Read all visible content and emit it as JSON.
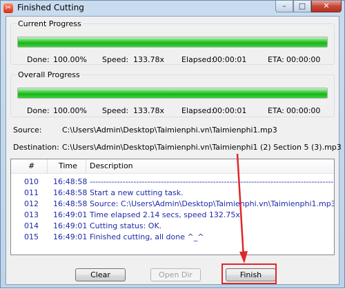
{
  "window": {
    "title": "Finished Cutting",
    "icon": "scissors-app-icon"
  },
  "title_buttons": {
    "minimize": "–",
    "maximize": "□",
    "close": "✕"
  },
  "current_progress": {
    "label": "Current Progress",
    "progress": 1.0,
    "done_label": "Done:",
    "done_value": "100.00%",
    "speed_label": "Speed:",
    "speed_value": "133.78x",
    "elapsed_label": "Elapsed:",
    "elapsed_value": "00:00:01",
    "eta_label": "ETA:",
    "eta_value": "00:00:00"
  },
  "overall_progress": {
    "label": "Overall Progress",
    "progress": 1.0,
    "done_label": "Done:",
    "done_value": "100.00%",
    "speed_label": "Speed:",
    "speed_value": "133.78x",
    "elapsed_label": "Elapsed:",
    "elapsed_value": "00:00:01",
    "eta_label": "ETA:",
    "eta_value": "00:00:00"
  },
  "source": {
    "label": "Source:",
    "value": "C:\\Users\\Admin\\Desktop\\Taimienphi.vn\\Taimienphi1.mp3"
  },
  "destination": {
    "label": "Destination:",
    "value": "C:\\Users\\Admin\\Desktop\\Taimienphi.vn\\Taimienphi1 (2)  Section 5 (3).mp3"
  },
  "log": {
    "columns": [
      "#",
      "Time",
      "Description"
    ],
    "rows": [
      {
        "num": "010",
        "time": "16:48:58",
        "desc": "----------------------------------------------------------------------------------------------------"
      },
      {
        "num": "011",
        "time": "16:48:58",
        "desc": "Start a new cutting task."
      },
      {
        "num": "012",
        "time": "16:48:58",
        "desc": "Source:  C:\\Users\\Admin\\Desktop\\Taimienphi.vn\\Taimienphi1.mp3."
      },
      {
        "num": "013",
        "time": "16:49:01",
        "desc": "Time elapsed 2.14 secs, speed 132.75x."
      },
      {
        "num": "014",
        "time": "16:49:01",
        "desc": "Cutting status: OK."
      },
      {
        "num": "015",
        "time": "16:49:01",
        "desc": "Finished cutting, all done ^_^"
      }
    ]
  },
  "buttons": {
    "clear": "Clear",
    "open_dir": "Open Dir",
    "finish": "Finish"
  },
  "colors": {
    "log_text": "#1c2aa8",
    "highlight": "#e0262a",
    "progress": "#18b418"
  }
}
